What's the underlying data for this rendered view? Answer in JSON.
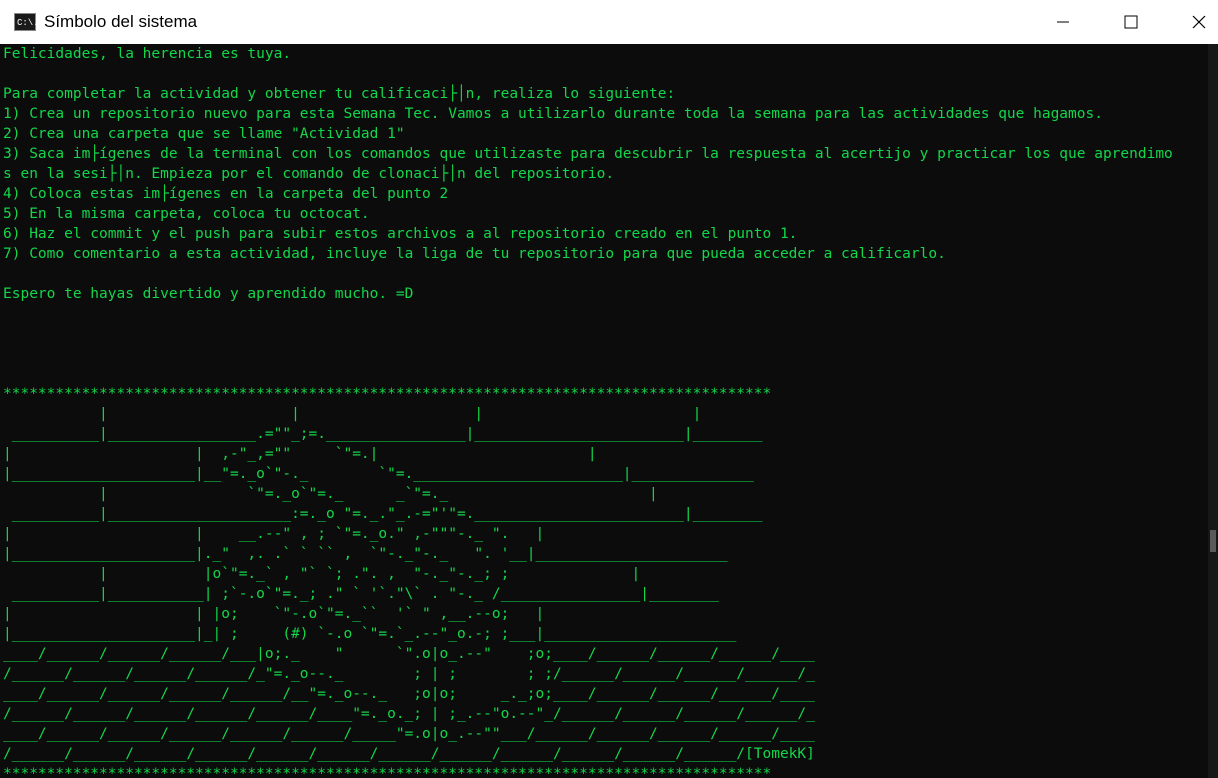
{
  "window": {
    "title": "Símbolo del sistema",
    "icon": "cmd-icon",
    "icon_text": "C:\\."
  },
  "controls": [
    "minimize-icon",
    "maximize-icon",
    "close-icon"
  ],
  "colors": {
    "terminal_text": "#13d64a",
    "terminal_bg": "#0c0c0c",
    "titlebar_bg": "#ffffff"
  },
  "terminal": {
    "lines": [
      "Felicidades, la herencia es tuya.",
      "",
      "Para completar la actividad y obtener tu calificaci├│n, realiza lo siguiente:",
      "1) Crea un repositorio nuevo para esta Semana Tec. Vamos a utilizarlo durante toda la semana para las actividades que hagamos.",
      "2) Crea una carpeta que se llame \"Actividad 1\"",
      "3) Saca im├ígenes de la terminal con los comandos que utilizaste para descubrir la respuesta al acertijo y practicar los que aprendimo",
      "s en la sesi├│n. Empieza por el comando de clonaci├│n del repositorio.",
      "4) Coloca estas im├ígenes en la carpeta del punto 2",
      "5) En la misma carpeta, coloca tu octocat.",
      "6) Haz el commit y el push para subir estos archivos a al repositorio creado en el punto 1.",
      "7) Como comentario a esta actividad, incluye la liga de tu repositorio para que pueda acceder a calificarlo.",
      "",
      "Espero te hayas divertido y aprendido mucho. =D",
      "",
      "",
      "",
      "",
      "****************************************************************************************",
      "           |                     |                    |                        |",
      " __________|_________________.=\"\"_;=.________________|________________________|________",
      "|                     |  ,-\"_,=\"\"     `\"=.|                        |",
      "|_____________________|__\"=._o`\"-._        `\"=.________________________|______________",
      "           |                `\"=._o`\"=._      _`\"=._                       |",
      " __________|_____________________:=._o \"=._.\"_.-=\"'\"=.________________________|________",
      "|                     |    __.--\" , ; `\"=._o.\" ,-\"\"\"-._ \".   |",
      "|_____________________|._\"  ,. .` ` `` ,  `\"-._\"-._   \". '__|______________________",
      "           |           |o`\"=._` , \"` `; .\". ,  \"-._\"-._; ;              |",
      " __________|___________| ;`-.o`\"=._; .\" ` '`.\"\\` . \"-._ /________________|________",
      "|                     | |o;    `\"-.o`\"=._``  '` \" ,__.--o;   |",
      "|_____________________|_| ;     (#) `-.o `\"=.`_.--\"_o.-; ;___|______________________",
      "____/______/______/______/___|o;._    \"      `\".o|o_.--\"    ;o;____/______/______/______/____",
      "/______/______/______/______/_\"=._o--._        ; | ;        ; ;/______/______/______/______/_",
      "____/______/______/______/______/__\"=._o--._   ;o|o;     _._;o;____/______/______/______/____",
      "/______/______/______/______/______/____\"=._o._; | ;_.--\"o.--\"_/______/______/______/______/_",
      "____/______/______/______/______/______/_____\"=.o|o_.--\"\"___/______/______/______/______/____",
      "/______/______/______/______/______/______/______/______/______/______/______/______/[TomekK]",
      "****************************************************************************************"
    ]
  }
}
